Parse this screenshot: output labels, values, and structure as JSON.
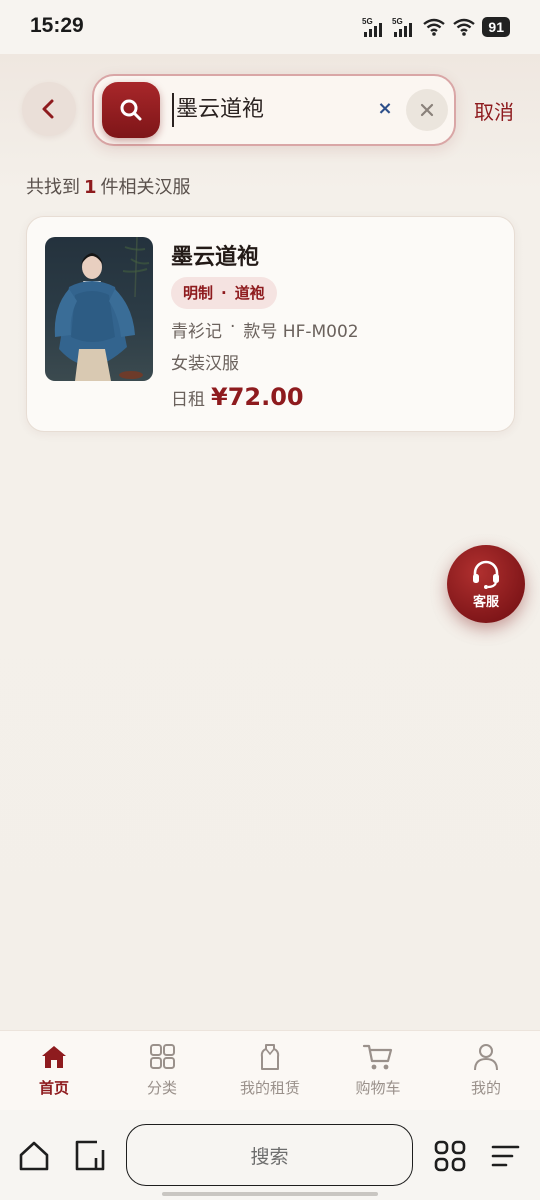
{
  "status_bar": {
    "time": "15:29",
    "signal1_label": "5G",
    "signal2_label": "5G",
    "battery": "91"
  },
  "header": {
    "search_value": "墨云道袍",
    "cancel_label": "取消"
  },
  "results": {
    "prefix": "共找到",
    "count": "1",
    "suffix": "件相关汉服"
  },
  "product": {
    "title": "墨云道袍",
    "tag_dynasty": "明制",
    "tag_sep": "·",
    "tag_style": "道袍",
    "shop": "青衫记",
    "meta_sep": "·",
    "sku": "款号 HF-M002",
    "category": "女装汉服",
    "price_label": "日租",
    "price": "¥72.00"
  },
  "service_fab": {
    "label": "客服"
  },
  "tab_bar": {
    "items": [
      {
        "label": "首页",
        "icon": "home-icon",
        "active": true
      },
      {
        "label": "分类",
        "icon": "grid-icon",
        "active": false
      },
      {
        "label": "我的租赁",
        "icon": "garment-icon",
        "active": false
      },
      {
        "label": "购物车",
        "icon": "cart-icon",
        "active": false
      },
      {
        "label": "我的",
        "icon": "user-icon",
        "active": false
      }
    ]
  },
  "browser_bar": {
    "search_label": "搜索"
  },
  "colors": {
    "accent": "#8e1b1e",
    "background": "#f3efe9",
    "card": "#fcfaf7",
    "tag_bg": "#f5e3e1"
  }
}
